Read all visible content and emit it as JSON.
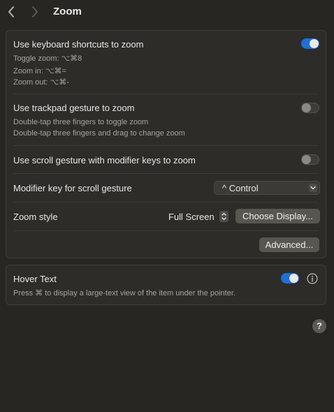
{
  "toolbar": {
    "title": "Zoom"
  },
  "zoom_panel": {
    "keyboard": {
      "label": "Use keyboard shortcuts to zoom",
      "enabled": true,
      "lines": [
        "Toggle zoom: ⌥⌘8",
        "Zoom in: ⌥⌘=",
        "Zoom out: ⌥⌘-"
      ]
    },
    "trackpad": {
      "label": "Use trackpad gesture to zoom",
      "enabled": false,
      "lines": [
        "Double-tap three fingers to toggle zoom",
        "Double-tap three fingers and drag to change zoom"
      ]
    },
    "scroll": {
      "label": "Use scroll gesture with modifier keys to zoom",
      "enabled": false
    },
    "modifier": {
      "label": "Modifier key for scroll gesture",
      "value": "^ Control"
    },
    "style": {
      "label": "Zoom style",
      "value": "Full Screen",
      "choose_display_label": "Choose Display..."
    },
    "advanced_label": "Advanced..."
  },
  "hover_panel": {
    "label": "Hover Text",
    "enabled": true,
    "description": "Press ⌘ to display a large-text view of the item under the pointer."
  },
  "help_label": "?",
  "colors": {
    "accent": "#1f6fd6",
    "background": "#272622",
    "panel": "#2d2c29"
  }
}
